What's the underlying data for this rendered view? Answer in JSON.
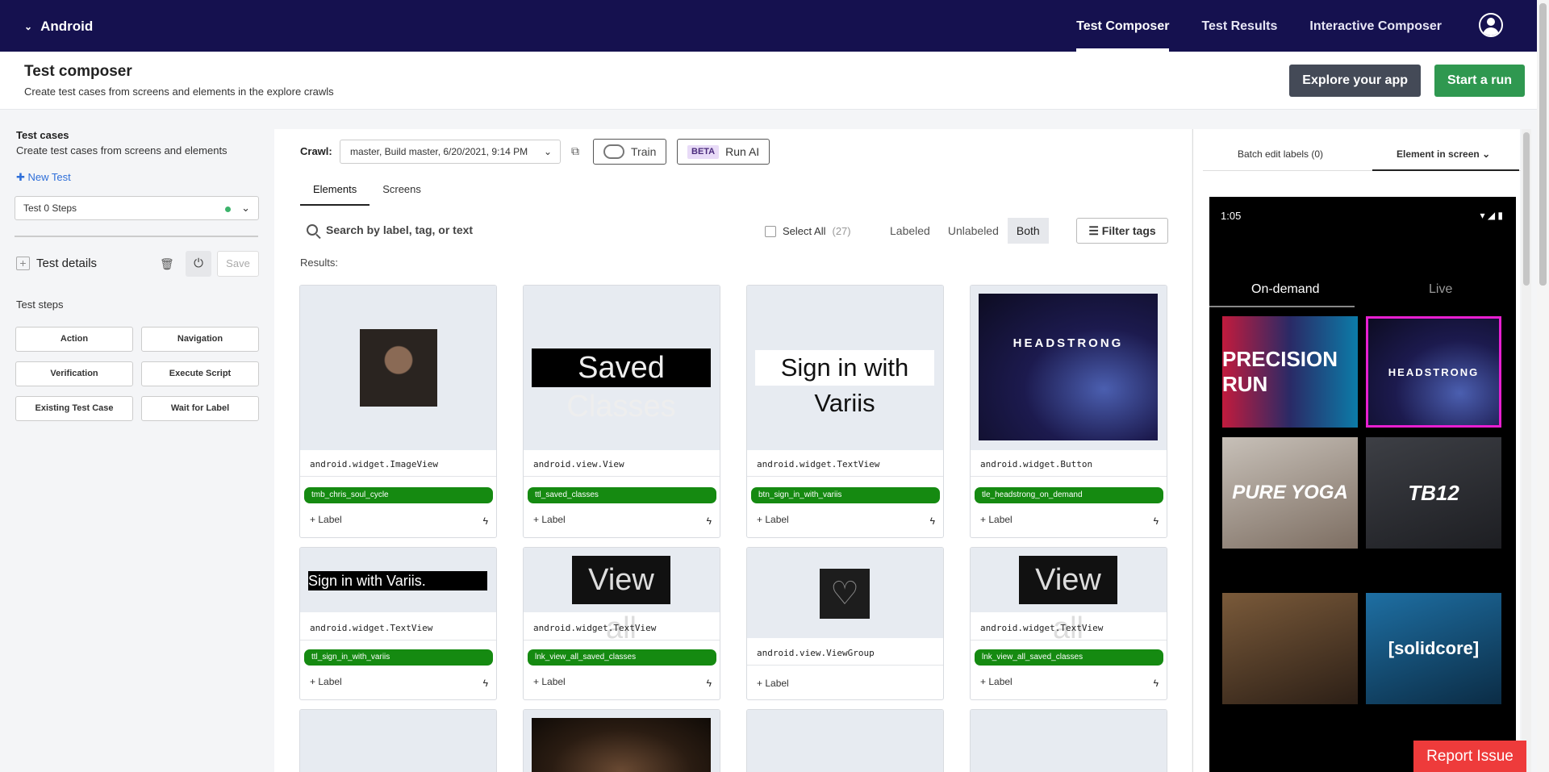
{
  "nav": {
    "app_name": "Android",
    "tabs": [
      "Test Composer",
      "Test Results",
      "Interactive Composer"
    ],
    "active_tab": "Test Composer"
  },
  "header": {
    "title": "Test composer",
    "subtitle": "Create test cases from screens and elements in the explore crawls",
    "explore_button": "Explore your app",
    "run_button": "Start a run"
  },
  "left": {
    "title": "Test cases",
    "subtitle": "Create test cases from screens and elements",
    "new_test": "New Test",
    "selected_test": "Test 0 Steps",
    "details_label": "Test details",
    "save_label": "Save",
    "steps_title": "Test steps",
    "step_buttons": [
      "Action",
      "Navigation",
      "Verification",
      "Execute Script",
      "Existing Test Case",
      "Wait for Label"
    ]
  },
  "center": {
    "crawl_label": "Crawl:",
    "crawl_value": "master, Build master, 6/20/2021, 9:14 PM",
    "train_label": "Train",
    "beta_badge": "BETA",
    "run_ai_label": "Run AI",
    "tabs": [
      "Elements",
      "Screens"
    ],
    "search_placeholder": "Search by label, tag, or text",
    "select_all": "Select All",
    "select_all_count": "(27)",
    "filters": [
      "Labeled",
      "Unlabeled",
      "Both"
    ],
    "active_filter": "Both",
    "filter_tags": "Filter tags",
    "results_label": "Results:",
    "add_label": "+ Label",
    "cards": [
      {
        "class": "android.widget.ImageView",
        "tag": "tmb_chris_soul_cycle",
        "thumb": "avatar"
      },
      {
        "class": "android.view.View",
        "tag": "ttl_saved_classes",
        "thumb": "Saved Classes"
      },
      {
        "class": "android.widget.TextView",
        "tag": "btn_sign_in_with_variis",
        "thumb": "Sign in with Variis"
      },
      {
        "class": "android.widget.Button",
        "tag": "tle_headstrong_on_demand",
        "thumb": "HEADSTRONG"
      },
      {
        "class": "android.widget.TextView",
        "tag": "ttl_sign_in_with_variis",
        "thumb": "Sign in with Variis."
      },
      {
        "class": "android.widget.TextView",
        "tag": "lnk_view_all_saved_classes",
        "thumb": "View all"
      },
      {
        "class": "android.view.ViewGroup",
        "tag": "",
        "thumb": "logo"
      },
      {
        "class": "android.widget.TextView",
        "tag": "lnk_view_all_saved_classes",
        "thumb": "View all"
      }
    ]
  },
  "right": {
    "batch_edit": "Batch edit labels (0)",
    "element_in_screen": "Element in screen",
    "phone": {
      "time": "1:05",
      "tabs": [
        "On-demand",
        "Live"
      ],
      "tiles": [
        "PRECISION RUN",
        "HEADSTRONG",
        "PURE YOGA",
        "TB12",
        "",
        "[solidcore]"
      ]
    }
  },
  "report_issue": "Report Issue"
}
